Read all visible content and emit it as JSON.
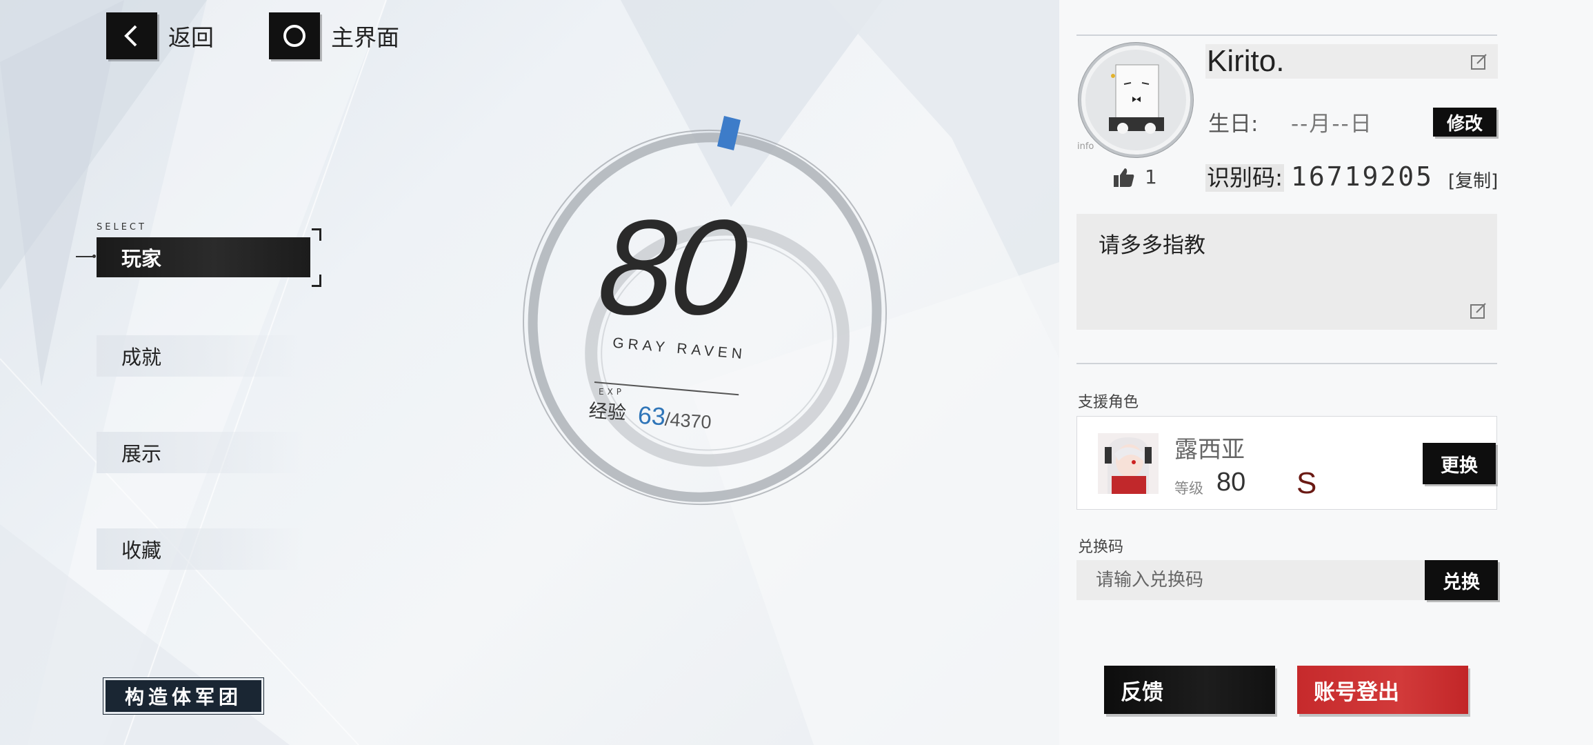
{
  "nav": {
    "back_label": "返回",
    "home_label": "主界面"
  },
  "menu": {
    "select_tag": "SELECT",
    "items": [
      {
        "label": "玩家",
        "active": true
      },
      {
        "label": "成就",
        "active": false
      },
      {
        "label": "展示",
        "active": false
      },
      {
        "label": "收藏",
        "active": false
      }
    ],
    "legion_label": "构造体军团"
  },
  "level": {
    "value": "80",
    "subtitle": "GRAY  RAVEN",
    "exp_tag": "EXP",
    "exp_label": "经验",
    "exp_current": "63",
    "exp_max": "/4370",
    "exp_fraction": 0.0144
  },
  "profile": {
    "avatar_tag": "info",
    "name": "Kirito.",
    "birthday_label": "生日:",
    "birthday_value": "--月--日",
    "modify_label": "修改",
    "likes": "1",
    "uid_label": "识别码:",
    "uid_value": "16719205",
    "copy_label": "[复制]",
    "signature": "请多多指教"
  },
  "support": {
    "title": "支援角色",
    "char_name": "露西亚",
    "level_label": "等级",
    "level_value": "80",
    "rank": "S",
    "change_label": "更换"
  },
  "redeem": {
    "title": "兑换码",
    "placeholder": "请输入兑换码",
    "button_label": "兑换"
  },
  "footer": {
    "feedback_label": "反馈",
    "logout_label": "账号登出"
  },
  "colors": {
    "accent_blue": "#2f75b8",
    "logout_red": "#c62a2c",
    "rank_color": "#6a1a14"
  }
}
